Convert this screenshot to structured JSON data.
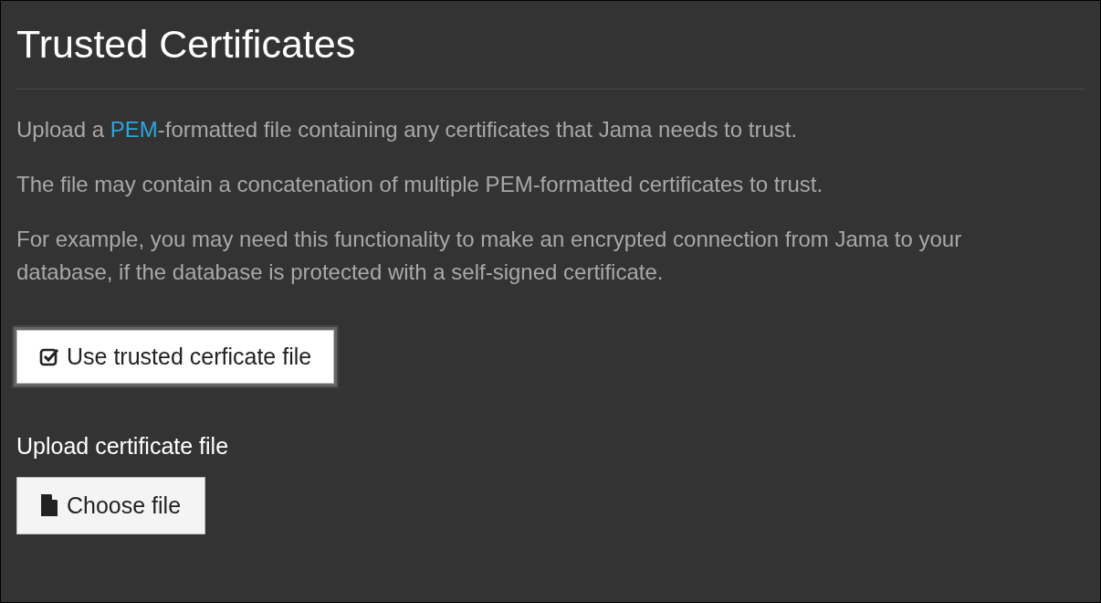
{
  "title": "Trusted Certificates",
  "intro": {
    "before": "Upload a ",
    "link": "PEM",
    "after": "-formatted file containing any certificates that Jama needs to trust."
  },
  "paragraphs": [
    "The file may contain a concatenation of multiple PEM-formatted certificates to trust.",
    "For example, you may need this functionality to make an encrypted connection from Jama to your database, if the database is protected with a self-signed certificate."
  ],
  "toggle": {
    "label": "Use trusted cerficate file",
    "checked": true
  },
  "upload": {
    "label": "Upload certificate file",
    "button": "Choose file"
  }
}
